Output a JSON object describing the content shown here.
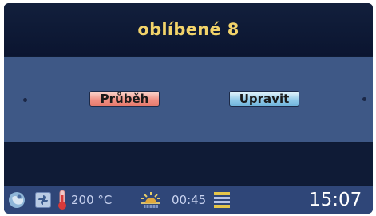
{
  "header": {
    "title": "oblíbené 8"
  },
  "main": {
    "progress_button_label": "Průběh",
    "edit_button_label": "Upravit"
  },
  "status_bar": {
    "icons": [
      "program-icon",
      "fan-icon",
      "thermometer-icon",
      "heating-mode-icon",
      "steam-level-icon"
    ],
    "temperature": "200 °C",
    "duration": "00:45",
    "clock": "15:07"
  },
  "colors": {
    "title": "#f2d36a",
    "panel": "#3e5886",
    "background": "#0e1a33",
    "status_bar": "#2f4678",
    "progress_button": "#f08e82",
    "edit_button": "#8fc9e8"
  }
}
